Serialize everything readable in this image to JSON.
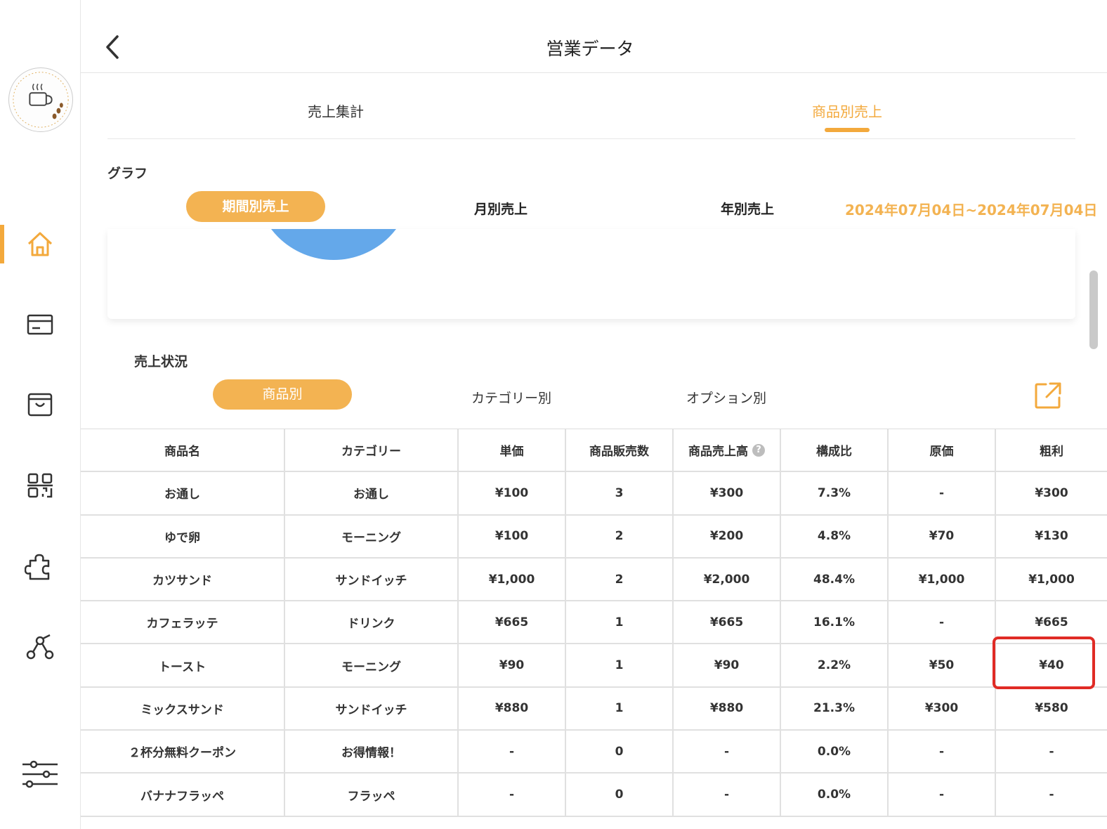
{
  "header": {
    "title": "営業データ"
  },
  "tabs": [
    {
      "label": "売上集計",
      "active": false
    },
    {
      "label": "商品別売上",
      "active": true
    }
  ],
  "graph": {
    "label": "グラフ",
    "periods": [
      "期間別売上",
      "月別売上",
      "年別売上"
    ],
    "date_range": "2024年07月04日~2024年07月04日"
  },
  "sales_status": {
    "label": "売上状況",
    "segments": [
      "商品別",
      "カテゴリー別",
      "オプション別"
    ]
  },
  "table": {
    "headers": [
      "商品名",
      "カテゴリー",
      "単価",
      "商品販売数",
      "商品売上高",
      "構成比",
      "原価",
      "粗利"
    ],
    "rows": [
      [
        "お通し",
        "お通し",
        "¥100",
        "3",
        "¥300",
        "7.3%",
        "-",
        "¥300"
      ],
      [
        "ゆで卵",
        "モーニング",
        "¥100",
        "2",
        "¥200",
        "4.8%",
        "¥70",
        "¥130"
      ],
      [
        "カツサンド",
        "サンドイッチ",
        "¥1,000",
        "2",
        "¥2,000",
        "48.4%",
        "¥1,000",
        "¥1,000"
      ],
      [
        "カフェラッテ",
        "ドリンク",
        "¥665",
        "1",
        "¥665",
        "16.1%",
        "-",
        "¥665"
      ],
      [
        "トースト",
        "モーニング",
        "¥90",
        "1",
        "¥90",
        "2.2%",
        "¥50",
        "¥40"
      ],
      [
        "ミックスサンド",
        "サンドイッチ",
        "¥880",
        "1",
        "¥880",
        "21.3%",
        "¥300",
        "¥580"
      ],
      [
        "２杯分無料クーポン",
        "お得情報！",
        "-",
        "0",
        "-",
        "0.0%",
        "-",
        "-"
      ],
      [
        "バナナフラッペ",
        "フラッペ",
        "-",
        "0",
        "-",
        "0.0%",
        "-",
        "-"
      ]
    ]
  },
  "colors": {
    "accent": "#f3b352",
    "highlight": "#e02b25",
    "pie": "#64a8ea"
  }
}
